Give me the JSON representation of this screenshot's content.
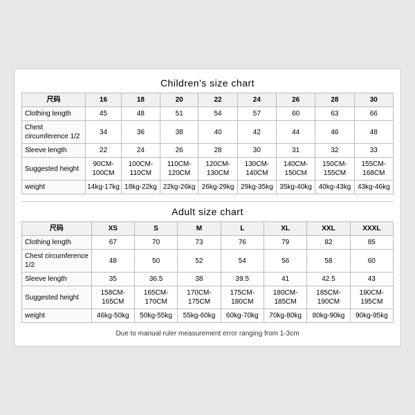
{
  "children_title": "Children's size chart",
  "adult_title": "Adult size chart",
  "note": "Due to manual ruler measurement error ranging from 1-3cm",
  "children": {
    "headers": [
      "尺码",
      "16",
      "18",
      "20",
      "22",
      "24",
      "26",
      "28",
      "30"
    ],
    "rows": [
      {
        "label": "Clothing length",
        "values": [
          "45",
          "48",
          "51",
          "54",
          "57",
          "60",
          "63",
          "66"
        ]
      },
      {
        "label": "Chest circumference 1/2",
        "values": [
          "34",
          "36",
          "38",
          "40",
          "42",
          "44",
          "46",
          "48"
        ]
      },
      {
        "label": "Sleeve length",
        "values": [
          "22",
          "24",
          "26",
          "28",
          "30",
          "31",
          "32",
          "33"
        ]
      },
      {
        "label": "Suggested height",
        "values": [
          "90CM-100CM",
          "100CM-110CM",
          "110CM-120CM",
          "120CM-130CM",
          "130CM-140CM",
          "140CM-150CM",
          "150CM-155CM",
          "155CM-168CM"
        ]
      },
      {
        "label": "weight",
        "values": [
          "14kg-17kg",
          "18kg-22kg",
          "22kg-26kg",
          "26kg-29kg",
          "29kg-35kg",
          "35kg-40kg",
          "40kg-43kg",
          "43kg-46kg"
        ]
      }
    ]
  },
  "adult": {
    "headers": [
      "尺码",
      "XS",
      "S",
      "M",
      "L",
      "XL",
      "XXL",
      "XXXL"
    ],
    "rows": [
      {
        "label": "Clothing length",
        "values": [
          "67",
          "70",
          "73",
          "76",
          "79",
          "82",
          "85"
        ]
      },
      {
        "label": "Chest circumference 1/2",
        "values": [
          "48",
          "50",
          "52",
          "54",
          "56",
          "58",
          "60"
        ]
      },
      {
        "label": "Sleeve length",
        "values": [
          "35",
          "36.5",
          "38",
          "39.5",
          "41",
          "42.5",
          "43"
        ]
      },
      {
        "label": "Suggested height",
        "values": [
          "158CM-165CM",
          "165CM-170CM",
          "170CM-175CM",
          "175CM-180CM",
          "180CM-185CM",
          "185CM-190CM",
          "190CM-195CM"
        ]
      },
      {
        "label": "weight",
        "values": [
          "46kg-50kg",
          "50kg-55kg",
          "55kg-60kg",
          "60kg-70kg",
          "70kg-80kg",
          "80kg-90kg",
          "90kg-95kg"
        ]
      }
    ]
  }
}
